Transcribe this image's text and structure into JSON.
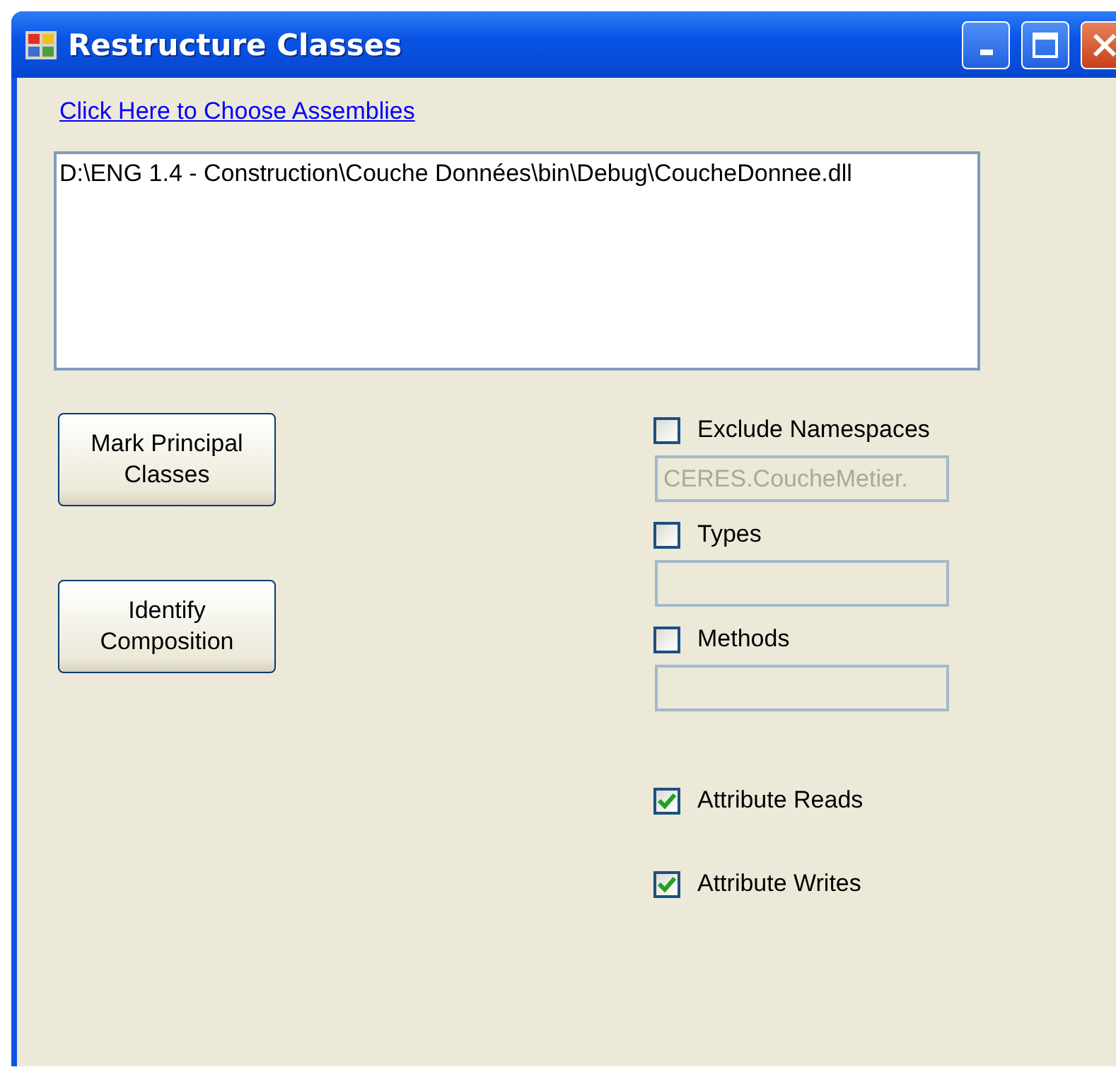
{
  "window": {
    "title": "Restructure Classes"
  },
  "link": "Click Here to Choose Assemblies",
  "assemblies": [
    "D:\\ENG 1.4 - Construction\\Couche Données\\bin\\Debug\\CoucheDonnee.dll"
  ],
  "buttons": [
    "Mark Principal Classes",
    "Identify Composition"
  ],
  "filters": [
    {
      "label": "Exclude Namespaces",
      "checked": false,
      "value": "CERES.CoucheMetier.",
      "disabled": true
    },
    {
      "label": "Types",
      "checked": false,
      "disabled": true
    },
    {
      "label": "Methods",
      "checked": false,
      "disabled": true
    }
  ],
  "attributes": [
    {
      "label": "Attribute Reads",
      "checked": true
    },
    {
      "label": "Attribute Writes",
      "checked": true
    }
  ]
}
